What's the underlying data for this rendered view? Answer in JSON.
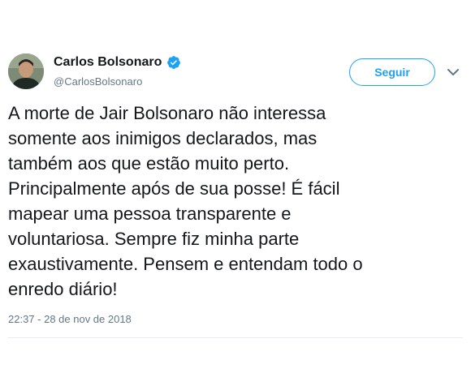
{
  "author": {
    "display_name": "Carlos Bolsonaro",
    "handle": "@CarlosBolsonaro",
    "verified": true,
    "avatar_icon": "profile-photo"
  },
  "actions": {
    "follow_label": "Seguir",
    "more_icon": "chevron-down-icon"
  },
  "tweet": {
    "lines": [
      "A morte de Jair Bolsonaro não interessa",
      "somente aos inimigos declarados, mas",
      "também aos que estão muito perto.",
      "Principalmente após de sua posse! É fácil",
      "mapear uma pessoa transparente e",
      "voluntariosa. Sempre fiz minha parte",
      "exaustivamente. Pensem e entendam todo o",
      "enredo diário!"
    ],
    "timestamp": "22:37 - 28 de nov de 2018"
  },
  "colors": {
    "accent": "#1da1f2",
    "text": "#14171a",
    "secondary_text": "#657786"
  }
}
